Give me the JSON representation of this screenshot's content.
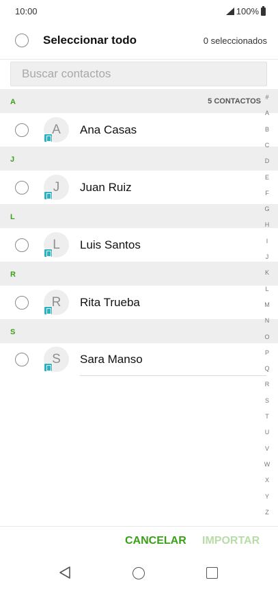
{
  "status_bar": {
    "time": "10:00",
    "battery": "100%"
  },
  "header": {
    "select_all_label": "Seleccionar todo",
    "selected_count": "0 seleccionados"
  },
  "search": {
    "placeholder": "Buscar contactos",
    "value": ""
  },
  "summary": {
    "contact_count": "5 CONTACTOS"
  },
  "sections": [
    {
      "letter": "A",
      "contacts": [
        {
          "initial": "A",
          "name": "Ana Casas"
        }
      ]
    },
    {
      "letter": "J",
      "contacts": [
        {
          "initial": "J",
          "name": "Juan Ruiz"
        }
      ]
    },
    {
      "letter": "L",
      "contacts": [
        {
          "initial": "L",
          "name": "Luis Santos"
        }
      ]
    },
    {
      "letter": "R",
      "contacts": [
        {
          "initial": "R",
          "name": "Rita Trueba"
        }
      ]
    },
    {
      "letter": "S",
      "contacts": [
        {
          "initial": "S",
          "name": "Sara Manso"
        }
      ]
    }
  ],
  "index_letters": [
    "#",
    "A",
    "B",
    "C",
    "D",
    "E",
    "F",
    "G",
    "H",
    "I",
    "J",
    "K",
    "L",
    "M",
    "N",
    "O",
    "P",
    "Q",
    "R",
    "S",
    "T",
    "U",
    "V",
    "W",
    "X",
    "Y",
    "Z"
  ],
  "actions": {
    "cancel": "CANCELAR",
    "import": "IMPORTAR"
  },
  "nav_icons": [
    "back-icon",
    "home-icon",
    "recent-apps-icon"
  ],
  "colors": {
    "accent": "#3aa017",
    "accent_disabled": "#b8dca8",
    "sim_badge": "#2bb3c4"
  }
}
